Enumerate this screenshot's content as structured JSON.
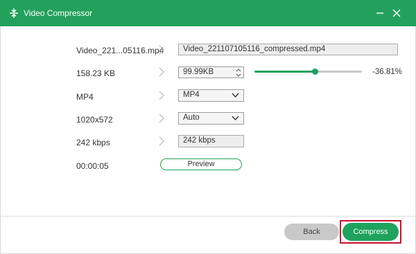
{
  "window": {
    "title": "Video Compressor"
  },
  "rows": {
    "name": {
      "label": "Video_221...05116.mp4",
      "value": "Video_221107105116_compressed.mp4"
    },
    "size": {
      "label": "158.23 KB",
      "value": "99.99KB",
      "slider_fraction": 0.56,
      "percent": "-36.81%"
    },
    "format": {
      "label": "MP4",
      "value": "MP4"
    },
    "resolution": {
      "label": "1020x572",
      "value": "Auto"
    },
    "bitrate": {
      "label": "242 kbps",
      "value": "242 kbps"
    },
    "duration": {
      "label": "00:00:05"
    }
  },
  "buttons": {
    "preview": "Preview",
    "back": "Back",
    "compress": "Compress"
  },
  "colors": {
    "accent": "#22a05c",
    "highlight": "#c8102e"
  }
}
